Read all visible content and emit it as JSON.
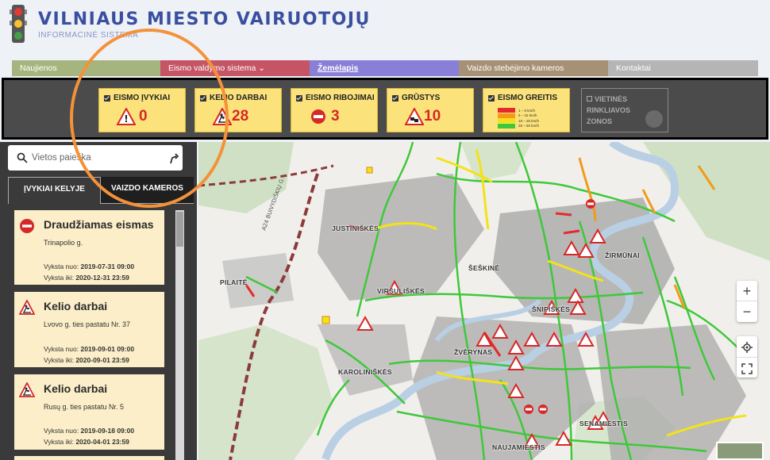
{
  "header": {
    "title": "VILNIAUS MIESTO VAIRUOTOJŲ",
    "subtitle": "INFORMACINĖ SISTEMA"
  },
  "nav": [
    {
      "label": "Naujienos",
      "color": "#a6b57e"
    },
    {
      "label": "Eismo valdymo sistema",
      "color": "#c55565"
    },
    {
      "label": "Žemėlapis",
      "color": "#8a7fd6"
    },
    {
      "label": "Vaizdo stebėjimo kameros",
      "color": "#a79174"
    },
    {
      "label": "Kontaktai",
      "color": "#b5b5b5"
    }
  ],
  "filters": [
    {
      "label": "EISMO ĮVYKIAI",
      "count": "0",
      "icon": "warning-triangle-icon"
    },
    {
      "label": "KELIO DARBAI",
      "count": "28",
      "icon": "roadwork-icon"
    },
    {
      "label": "EISMO RIBOJIMAI",
      "count": "3",
      "icon": "no-entry-icon"
    },
    {
      "label": "GRŪSTYS",
      "count": "10",
      "icon": "traffic-jam-icon"
    }
  ],
  "speed_legend": {
    "label": "EISMO GREITIS",
    "rows": [
      {
        "text": "1 – 5 km/h",
        "color": "#e32b2b"
      },
      {
        "text": "6 – 15 km/h",
        "color": "#f39a1a"
      },
      {
        "text": "16 – 25 km/h",
        "color": "#f3e21a"
      },
      {
        "text": "26 – 60 km/h",
        "color": "#3fc83a"
      }
    ]
  },
  "zones": {
    "line1": "VIETINĖS",
    "line2": "RINKLIAVOS",
    "line3": "ZONOS"
  },
  "search": {
    "placeholder": "Vietos paieška"
  },
  "panel_tabs": [
    {
      "label": "ĮVYKIAI KELYJE"
    },
    {
      "label": "VAIZDO KAMEROS"
    }
  ],
  "events": [
    {
      "type": "no-entry",
      "title": "Draudžiamas eismas",
      "location": "Trinapolio g.",
      "from_label": "Vyksta nuo:",
      "from": "2019-07-31 09:00",
      "to_label": "Vyksta iki:",
      "to": "2020-12-31 23:59"
    },
    {
      "type": "roadwork",
      "title": "Kelio darbai",
      "location": "Lvovo g. ties pastatu Nr. 37",
      "from_label": "Vyksta nuo:",
      "from": "2019-09-01 09:00",
      "to_label": "Vyksta iki:",
      "to": "2020-09-01 23:59"
    },
    {
      "type": "roadwork",
      "title": "Kelio darbai",
      "location": "Rusų g. ties pastatu Nr. 5",
      "from_label": "Vyksta nuo:",
      "from": "2019-09-18 09:00",
      "to_label": "Vyksta iki:",
      "to": "2020-04-01 23:59"
    }
  ],
  "map": {
    "labels": [
      "JUSTINIŠKĖS",
      "PILAITĖ",
      "ŠEŠKINĖ",
      "ŽIRMŪNAI",
      "VIRŠULIŠKĖS",
      "ŠNIPIŠKĖS",
      "ŽVĖRYNAS",
      "KAROLINIŠKĖS",
      "SENAMIESTIS",
      "NAUJAMIESTIS"
    ],
    "road_label": "A24 BUIVYDIŠKIŲ G.",
    "zoom_in": "+",
    "zoom_out": "−"
  }
}
